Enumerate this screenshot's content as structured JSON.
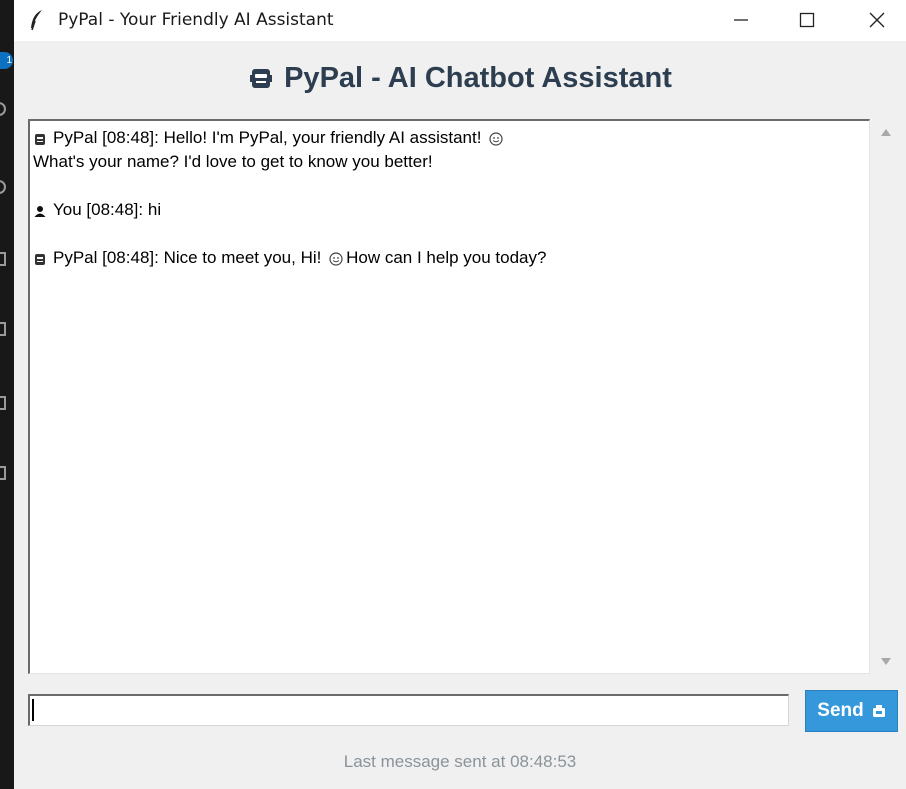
{
  "window": {
    "title": "PyPal - Your Friendly AI Assistant"
  },
  "background": {
    "badge_count": "1"
  },
  "header": {
    "title": "PyPal - AI Chatbot Assistant",
    "icon": "robot-icon"
  },
  "chat": {
    "messages": [
      {
        "sender_icon": "robot-icon",
        "prefix": "PyPal [08:48]: ",
        "line1": "Hello! I'm PyPal, your friendly AI assistant!",
        "emoji": "smiley-icon",
        "line2": "What's your name? I'd love to get to know you better!"
      },
      {
        "sender_icon": "user-icon",
        "prefix": "You [08:48]: ",
        "line1": "hi"
      },
      {
        "sender_icon": "robot-icon",
        "prefix": "PyPal [08:48]: ",
        "line1_a": "Nice to meet you, Hi!",
        "emoji": "smiley-icon",
        "line1_b": "How can I help you today?"
      }
    ]
  },
  "input": {
    "value": "",
    "placeholder": ""
  },
  "send_button": {
    "label": "Send",
    "icon": "send-icon"
  },
  "status": {
    "text": "Last message sent at 08:48:53"
  },
  "colors": {
    "accent": "#3498db",
    "heading": "#2c3e50",
    "status_text": "#8a939a",
    "window_bg": "#f0f0f0"
  }
}
